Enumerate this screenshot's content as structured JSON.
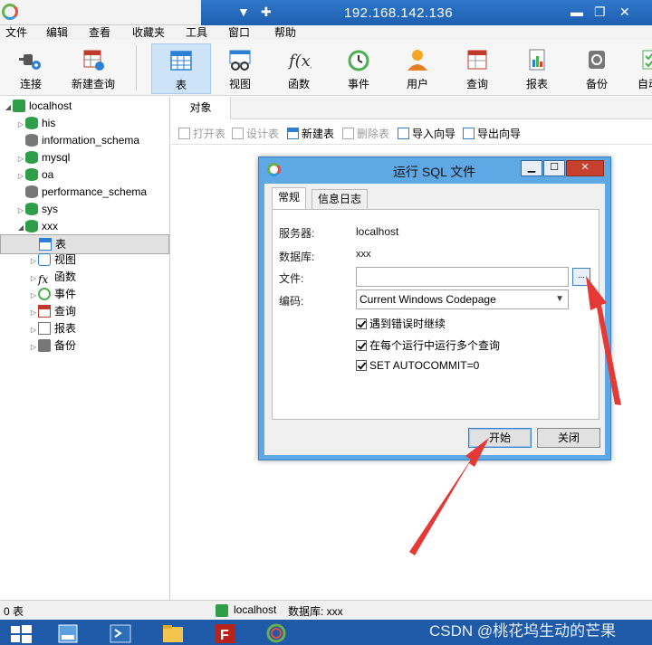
{
  "window": {
    "ip_title": "192.168.142.136"
  },
  "menu": [
    "文件",
    "编辑",
    "查看",
    "收藏夹",
    "工具",
    "窗口",
    "帮助"
  ],
  "toolbar": {
    "items": [
      "连接",
      "新建查询",
      "表",
      "视图",
      "函数",
      "事件",
      "用户",
      "查询",
      "报表",
      "备份",
      "自动"
    ]
  },
  "tree": {
    "root": "localhost",
    "databases": [
      "his",
      "information_schema",
      "mysql",
      "oa",
      "performance_schema",
      "sys",
      "xxx"
    ],
    "xxx_children": [
      "表",
      "视图",
      "函数",
      "事件",
      "查询",
      "报表",
      "备份"
    ]
  },
  "object_tab": "对象",
  "object_toolbar": {
    "open": "打开表",
    "design": "设计表",
    "new": "新建表",
    "delete": "删除表",
    "import": "导入向导",
    "export": "导出向导"
  },
  "status": {
    "count": "0 表",
    "connection": "localhost",
    "database": "数据库: xxx"
  },
  "dialog": {
    "title": "运行 SQL 文件",
    "tabs": [
      "常规",
      "信息日志"
    ],
    "server_label": "服务器:",
    "server_value": "localhost",
    "database_label": "数据库:",
    "database_value": "xxx",
    "file_label": "文件:",
    "file_value": "",
    "browse_label": "...",
    "encoding_label": "编码:",
    "encoding_value": "Current Windows Codepage",
    "options": [
      "遇到错误时继续",
      "在每个运行中运行多个查询",
      "SET AUTOCOMMIT=0"
    ],
    "start_button": "开始",
    "close_button": "关闭"
  },
  "watermark": "CSDN @桃花坞生动的芒果",
  "colors": {
    "titlebar": "#1e5fb0",
    "dialog_frame": "#5fa8e6",
    "arrow": "#e53935",
    "taskbar": "#1e5aa8"
  }
}
